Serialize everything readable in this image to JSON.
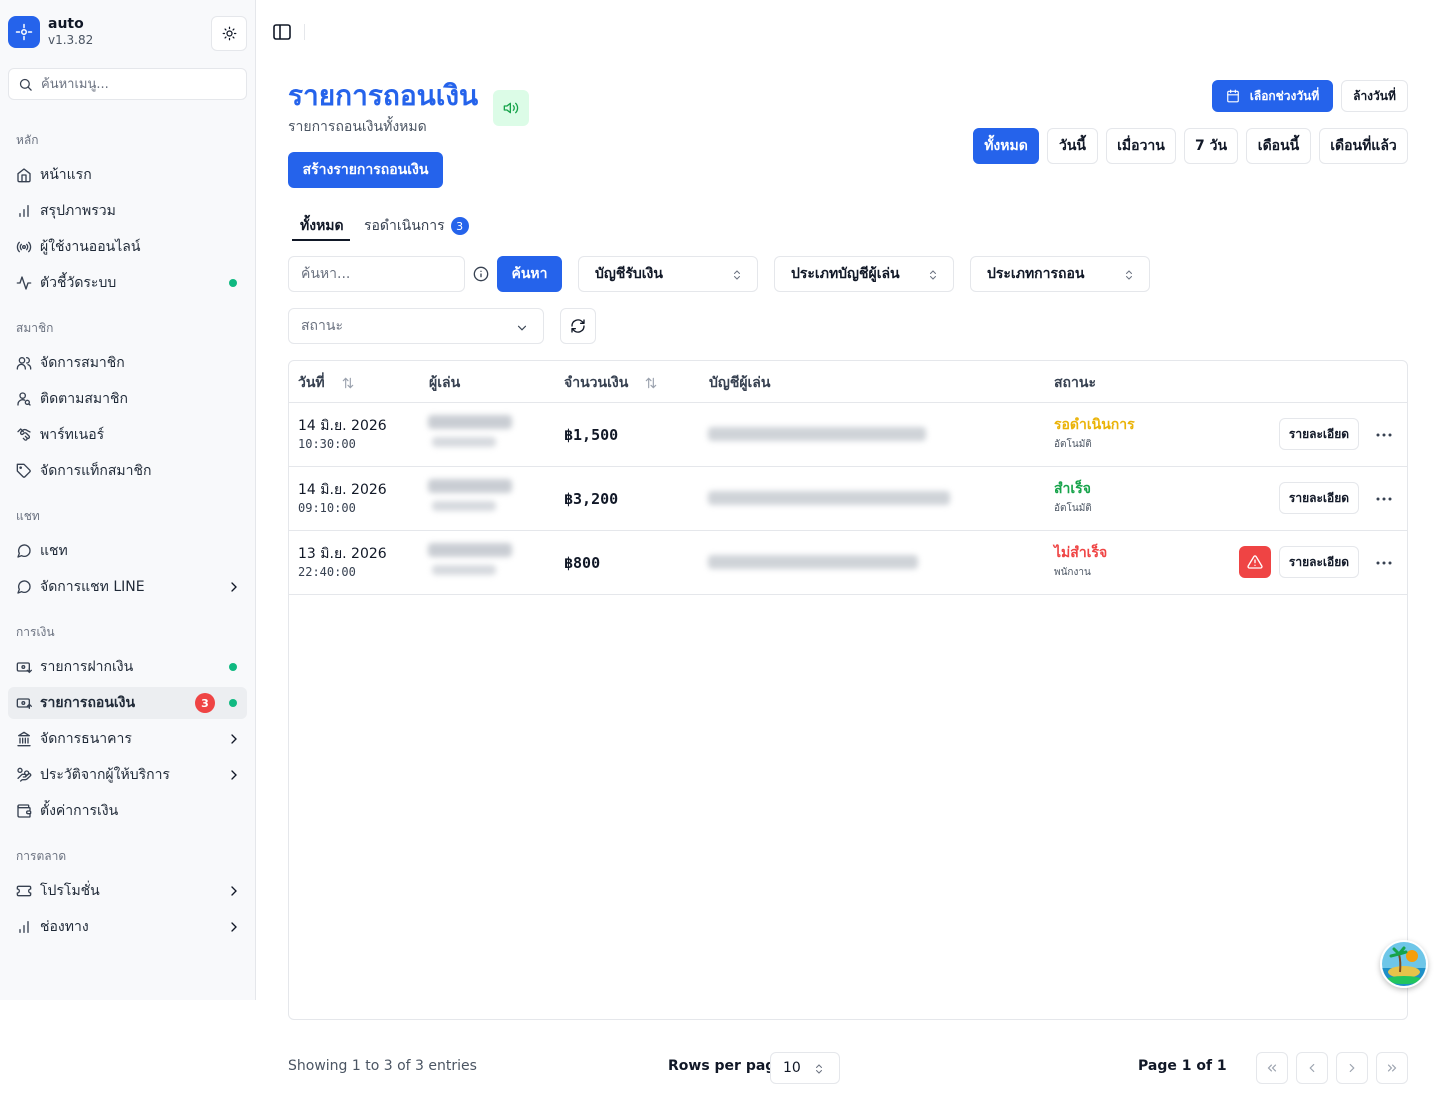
{
  "app": {
    "name": "auto",
    "version": "v1.3.82"
  },
  "colors": {
    "accent": "#2563eb",
    "success": "#16a34a",
    "pending": "#eab308",
    "danger": "#ef4444",
    "online_dot": "#10b981"
  },
  "sidebar": {
    "search_placeholder": "ค้นหาเมนู...",
    "groups": {
      "main": "หลัก",
      "members": "สมาชิก",
      "chat": "แชท",
      "finance": "การเงิน",
      "marketing": "การตลาด"
    },
    "items": {
      "home": "หน้าแรก",
      "overview": "สรุปภาพรวม",
      "online_users": "ผู้ใช้งานออนไลน์",
      "system_metrics": "ตัวชี้วัดระบบ",
      "manage_members": "จัดการสมาชิก",
      "track_members": "ติดตามสมาชิก",
      "partners": "พาร์ทเนอร์",
      "member_tags": "จัดการแท็กสมาชิก",
      "chat": "แชท",
      "line_chat": "จัดการแชท LINE",
      "deposits": "รายการฝากเงิน",
      "withdrawals": "รายการถอนเงิน",
      "withdrawals_badge": "3",
      "banks": "จัดการธนาคาร",
      "provider_history": "ประวัติจากผู้ให้บริการ",
      "finance_settings": "ตั้งค่าการเงิน",
      "promotions": "โปรโมชั่น",
      "channels": "ช่องทาง"
    }
  },
  "header": {
    "title": "รายการถอนเงิน",
    "subtitle": "รายการถอนเงินทั้งหมด",
    "create_button": "สร้างรายการถอนเงิน",
    "date_range_button": "เลือกช่วงวันที่",
    "clear_date_button": "ล้างวันที่",
    "quick_ranges": [
      "ทั้งหมด",
      "วันนี้",
      "เมื่อวาน",
      "7 วัน",
      "เดือนนี้",
      "เดือนที่แล้ว"
    ]
  },
  "tabs": {
    "all": "ทั้งหมด",
    "pending": "รอดำเนินการ",
    "pending_count": "3"
  },
  "filters": {
    "search_placeholder": "ค้นหา...",
    "search_button": "ค้นหา",
    "receiving_account": "บัญชีรับเงิน",
    "player_account_type": "ประเภทบัญชีผู้เล่น",
    "withdraw_type": "ประเภทการถอน",
    "status_placeholder": "สถานะ"
  },
  "table": {
    "columns": {
      "date": "วันที่",
      "player": "ผู้เล่น",
      "amount": "จำนวนเงิน",
      "player_account": "บัญชีผู้เล่น",
      "status": "สถานะ"
    },
    "detail_label": "รายละเอียด",
    "rows": [
      {
        "date": "14 มิ.ย. 2026",
        "time": "10:30:00",
        "amount": "฿1,500",
        "status": "รอดำเนินการ",
        "status_color": "#eab308",
        "method": "อัตโนมัติ"
      },
      {
        "date": "14 มิ.ย. 2026",
        "time": "09:10:00",
        "amount": "฿3,200",
        "status": "สำเร็จ",
        "status_color": "#16a34a",
        "method": "อัตโนมัติ"
      },
      {
        "date": "13 มิ.ย. 2026",
        "time": "22:40:00",
        "amount": "฿800",
        "status": "ไม่สำเร็จ",
        "status_color": "#ef4444",
        "method": "พนักงาน"
      }
    ]
  },
  "footer": {
    "showing": "Showing 1 to 3 of 3 entries",
    "rows_per_page_label": "Rows per page",
    "rows_per_page_value": "10",
    "page_info": "Page 1 of 1"
  }
}
